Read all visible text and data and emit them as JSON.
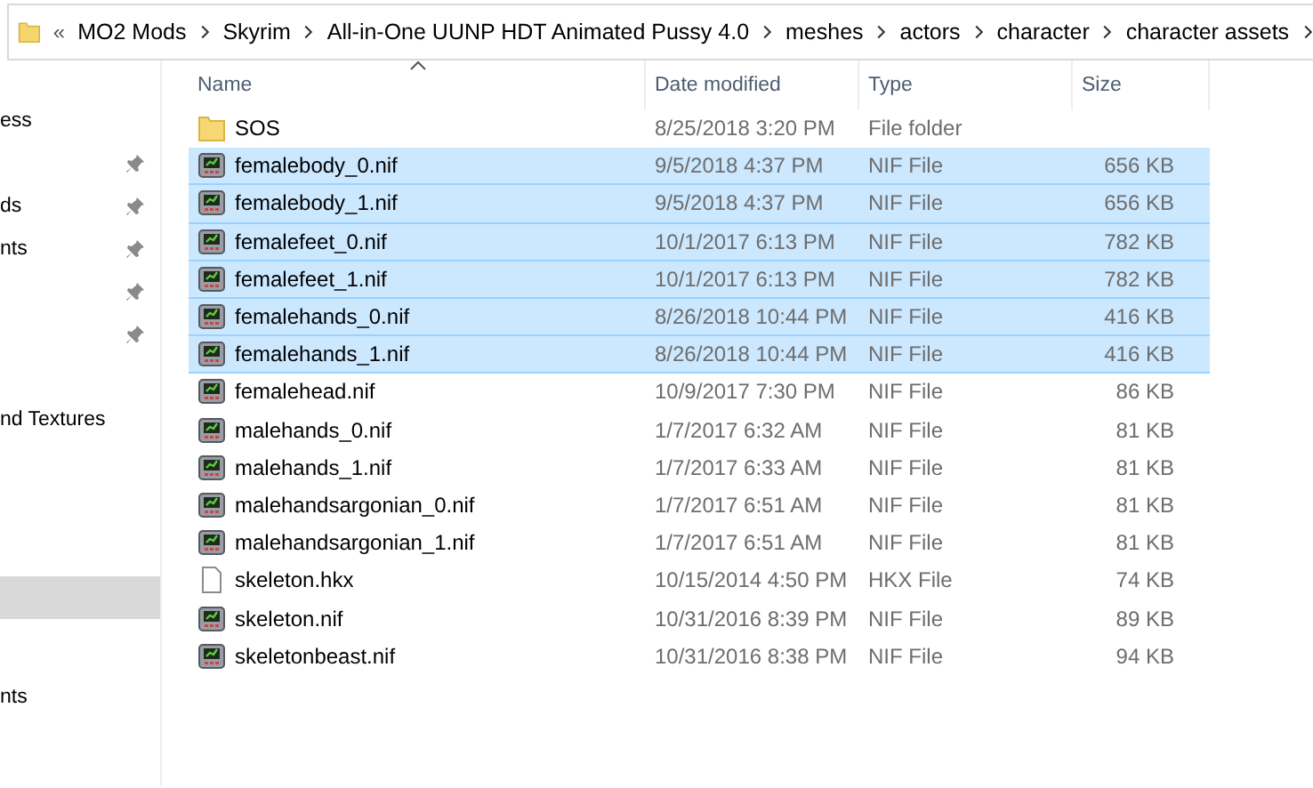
{
  "breadcrumb": {
    "overflow": "«",
    "parts": [
      "MO2 Mods",
      "Skyrim",
      "All-in-One UUNP HDT Animated Pussy 4.0",
      "meshes",
      "actors",
      "character",
      "character assets"
    ]
  },
  "sidebar": {
    "groups": [
      [
        {
          "label": "ess",
          "pinned": false,
          "selected": false
        },
        {
          "pinned": true,
          "selected": false
        },
        {
          "label": "ds",
          "pinned": true,
          "selected": false
        },
        {
          "label": "nts",
          "pinned": true,
          "selected": false
        },
        {
          "pinned": true,
          "selected": false
        },
        {
          "pinned": true,
          "selected": false
        }
      ],
      [
        {
          "label": "nd Textures",
          "pinned": false,
          "selected": false
        }
      ],
      [
        {
          "pinned": false,
          "selected": true
        }
      ],
      [
        {
          "label": "nts",
          "pinned": false,
          "selected": false
        }
      ]
    ]
  },
  "columns": [
    {
      "label": "Name",
      "sorted": true
    },
    {
      "label": "Date modified",
      "sorted": false
    },
    {
      "label": "Type",
      "sorted": false
    },
    {
      "label": "Size",
      "sorted": false
    }
  ],
  "files": [
    {
      "name": "SOS",
      "date": "8/25/2018 3:20 PM",
      "type": "File folder",
      "kind": "folder",
      "selected": false
    },
    {
      "name": "femalebody_0.nif",
      "date": "9/5/2018 4:37 PM",
      "type": "NIF File",
      "size": "656 KB",
      "kind": "nif",
      "selected": true
    },
    {
      "name": "femalebody_1.nif",
      "date": "9/5/2018 4:37 PM",
      "type": "NIF File",
      "size": "656 KB",
      "kind": "nif",
      "selected": true
    },
    {
      "name": "femalefeet_0.nif",
      "date": "10/1/2017 6:13 PM",
      "type": "NIF File",
      "size": "782 KB",
      "kind": "nif",
      "selected": true
    },
    {
      "name": "femalefeet_1.nif",
      "date": "10/1/2017 6:13 PM",
      "type": "NIF File",
      "size": "782 KB",
      "kind": "nif",
      "selected": true
    },
    {
      "name": "femalehands_0.nif",
      "date": "8/26/2018 10:44 PM",
      "type": "NIF File",
      "size": "416 KB",
      "kind": "nif",
      "selected": true
    },
    {
      "name": "femalehands_1.nif",
      "date": "8/26/2018 10:44 PM",
      "type": "NIF File",
      "size": "416 KB",
      "kind": "nif",
      "selected": true
    },
    {
      "name": "femalehead.nif",
      "date": "10/9/2017 7:30 PM",
      "type": "NIF File",
      "size": "86 KB",
      "kind": "nif",
      "selected": false
    },
    {
      "name": "malehands_0.nif",
      "date": "1/7/2017 6:32 AM",
      "type": "NIF File",
      "size": "81 KB",
      "kind": "nif",
      "selected": false
    },
    {
      "name": "malehands_1.nif",
      "date": "1/7/2017 6:33 AM",
      "type": "NIF File",
      "size": "81 KB",
      "kind": "nif",
      "selected": false
    },
    {
      "name": "malehandsargonian_0.nif",
      "date": "1/7/2017 6:51 AM",
      "type": "NIF File",
      "size": "81 KB",
      "kind": "nif",
      "selected": false
    },
    {
      "name": "malehandsargonian_1.nif",
      "date": "1/7/2017 6:51 AM",
      "type": "NIF File",
      "size": "81 KB",
      "kind": "nif",
      "selected": false
    },
    {
      "name": "skeleton.hkx",
      "date": "10/15/2014 4:50 PM",
      "type": "HKX File",
      "size": "74 KB",
      "kind": "file",
      "selected": false
    },
    {
      "name": "skeleton.nif",
      "date": "10/31/2016 8:39 PM",
      "type": "NIF File",
      "size": "89 KB",
      "kind": "nif",
      "selected": false
    },
    {
      "name": "skeletonbeast.nif",
      "date": "10/31/2016 8:38 PM",
      "type": "NIF File",
      "size": "94 KB",
      "kind": "nif",
      "selected": false
    }
  ]
}
